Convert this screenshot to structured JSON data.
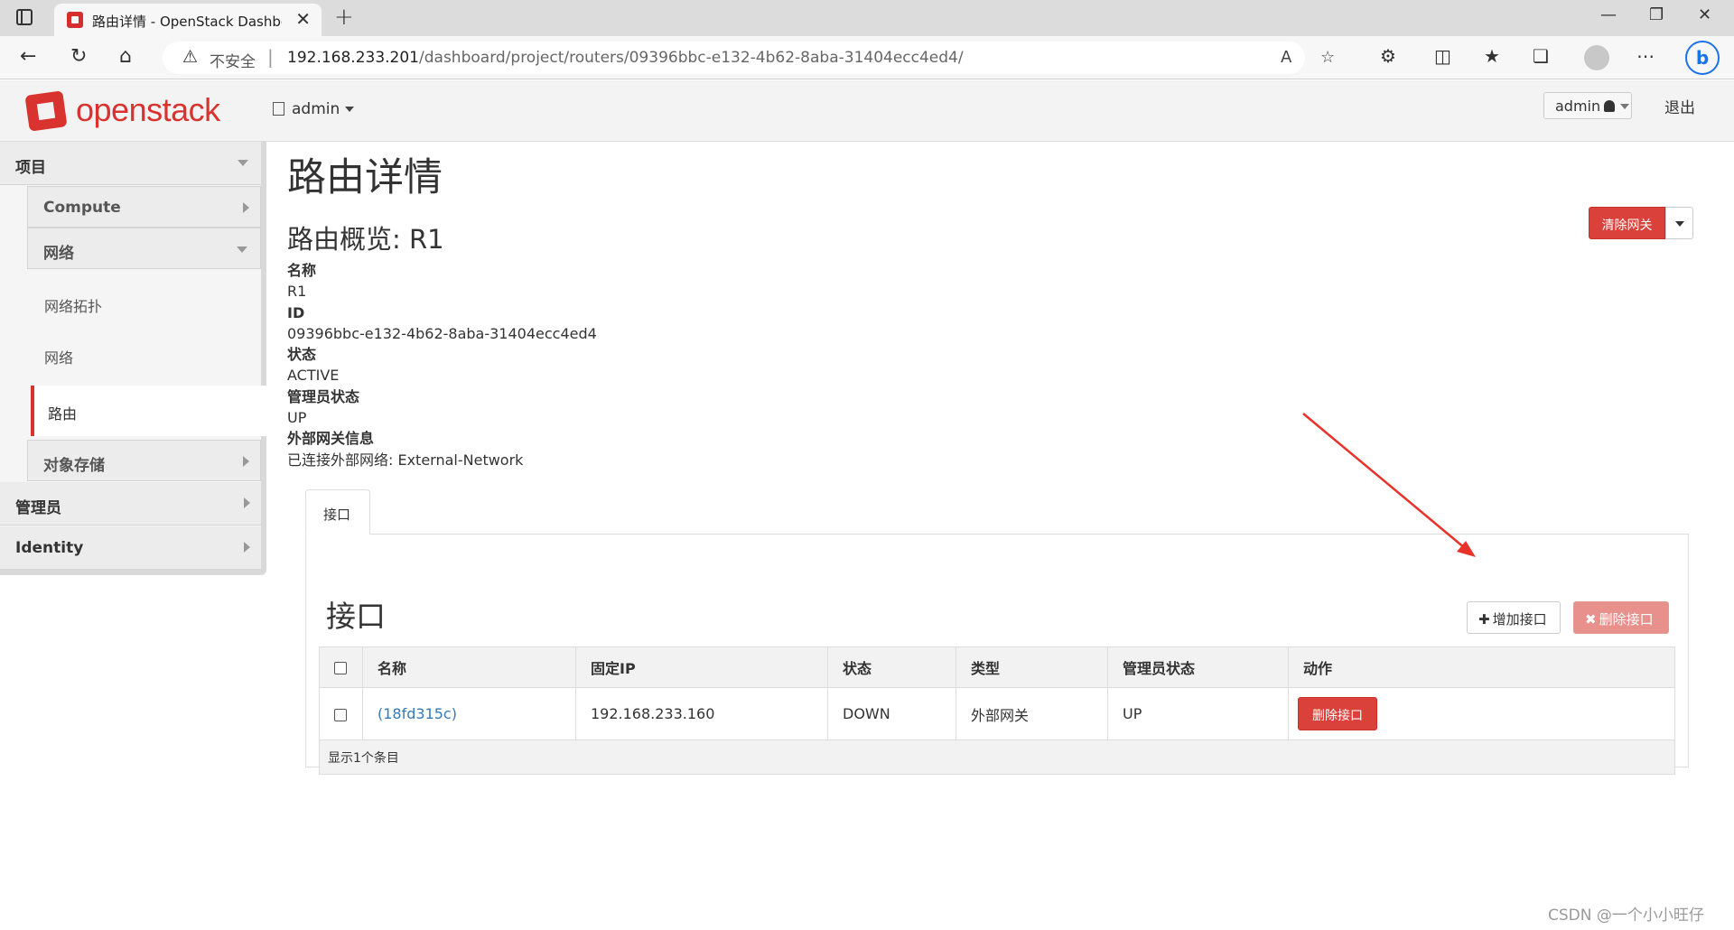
{
  "browser": {
    "tab_title": "路由详情 - OpenStack Dashboard",
    "url_warning": "不安全",
    "url_host": "192.168.233.201",
    "url_path": "/dashboard/project/routers/09396bbc-e132-4b62-8aba-31404ecc4ed4/",
    "icons": [
      "sidebar-toggle-icon",
      "back-icon",
      "reload-icon",
      "home-icon",
      "warning-icon",
      "read-aloud-icon",
      "add-favorite-icon",
      "extensions-icon",
      "split-screen-icon",
      "favorites-icon",
      "collections-icon",
      "profile-icon",
      "more-icon",
      "bing-icon"
    ]
  },
  "header": {
    "logo_text": "openstack",
    "project_label": "admin",
    "user_label": "admin",
    "signout_label": "退出"
  },
  "sidebar": {
    "project": "项目",
    "compute": "Compute",
    "network": "网络",
    "network_topology": "网络拓扑",
    "networks": "网络",
    "routers": "路由",
    "object_store": "对象存储",
    "admin": "管理员",
    "identity": "Identity"
  },
  "main": {
    "page_title": "路由详情",
    "clear_gateway_label": "清除网关",
    "overview_title": "路由概览: R1",
    "details": [
      {
        "term": "名称",
        "value": "R1"
      },
      {
        "term": "ID",
        "value": "09396bbc-e132-4b62-8aba-31404ecc4ed4"
      },
      {
        "term": "状态",
        "value": "ACTIVE"
      },
      {
        "term": "管理员状态",
        "value": "UP"
      },
      {
        "term": "外部网关信息",
        "value": "已连接外部网络: External-Network"
      }
    ],
    "tab_label": "接口",
    "section_title": "接口",
    "add_interface_label": "增加接口",
    "delete_interfaces_label": "删除接口",
    "table": {
      "headers": [
        "名称",
        "固定IP",
        "状态",
        "类型",
        "管理员状态",
        "动作"
      ],
      "rows": [
        {
          "name": "(18fd315c)",
          "fixed_ip": "192.168.233.160",
          "status": "DOWN",
          "type": "外部网关",
          "admin_state": "UP",
          "action": "删除接口"
        }
      ],
      "footer": "显示1个条目"
    }
  },
  "watermark": "CSDN @一个小小旺仔",
  "colors": {
    "brand_red": "#d9332f",
    "danger": "#d9413a",
    "link": "#337ab7",
    "annotation_arrow": "#e8332b"
  }
}
